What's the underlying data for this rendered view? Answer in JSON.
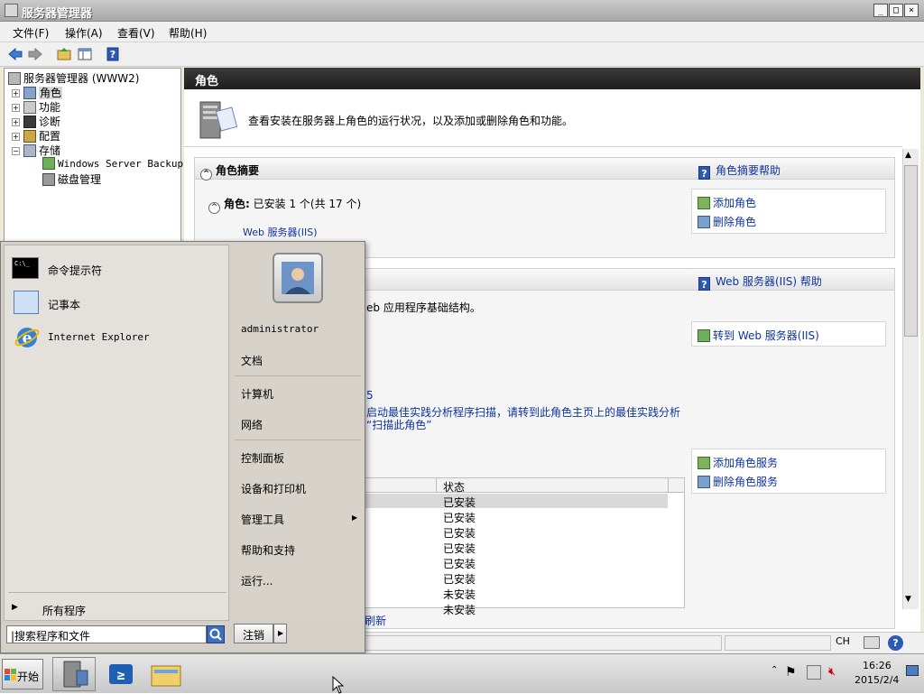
{
  "window": {
    "title": "服务器管理器",
    "controls": {
      "minimize": "_",
      "restore": "□",
      "close": "×"
    }
  },
  "menubar": {
    "items": [
      "文件(F)",
      "操作(A)",
      "查看(V)",
      "帮助(H)"
    ]
  },
  "tree": {
    "root": "服务器管理器 (WWW2)",
    "items": [
      {
        "label": "角色",
        "expander": "+"
      },
      {
        "label": "功能",
        "expander": "+"
      },
      {
        "label": "诊断",
        "expander": "+"
      },
      {
        "label": "配置",
        "expander": "+"
      },
      {
        "label": "存储",
        "expander": "−"
      }
    ],
    "storage_children": [
      "Windows Server Backup",
      "磁盘管理"
    ]
  },
  "content": {
    "header": "角色",
    "description": "查看安装在服务器上角色的运行状况，以及添加或删除角色和功能。",
    "summary": {
      "title": "角色摘要",
      "help_link": "角色摘要帮助",
      "roles_label": "角色:",
      "roles_status": "已安装 1 个(共 17 个)",
      "installed_role": "Web 服务器(IIS)",
      "actions": [
        "添加角色",
        "删除角色"
      ]
    },
    "iis": {
      "help_link": "Web 服务器(IIS) 帮助",
      "description_fragment": "eb 应用程序基础结构。",
      "goto_link": "转到 Web 服务器(IIS)",
      "bpa_fragment_1": "5",
      "bpa_fragment_2": "启动最佳实践分析程序扫描，请转到此角色主页上的最佳实践分析",
      "bpa_fragment_3": "“扫描此角色”",
      "actions": [
        "添加角色服务",
        "删除角色服务"
      ],
      "table_header": "状态",
      "statuses": [
        "已安装",
        "已安装",
        "已安装",
        "已安装",
        "已安装",
        "已安装",
        "未安装",
        "未安装"
      ]
    },
    "refresh_fragment": "刷新"
  },
  "statusbar": {
    "lang": "CH"
  },
  "start_menu": {
    "programs": [
      "命令提示符",
      "记事本",
      "Internet Explorer"
    ],
    "all_programs": "所有程序",
    "search_placeholder": "搜索程序和文件",
    "user": "administrator",
    "right_items": [
      "文档",
      "计算机",
      "网络",
      "控制面板",
      "设备和打印机",
      "管理工具",
      "帮助和支持",
      "运行..."
    ],
    "logoff": "注销"
  },
  "taskbar": {
    "start_label": "开始",
    "clock_time": "16:26",
    "clock_date": "2015/2/4"
  }
}
